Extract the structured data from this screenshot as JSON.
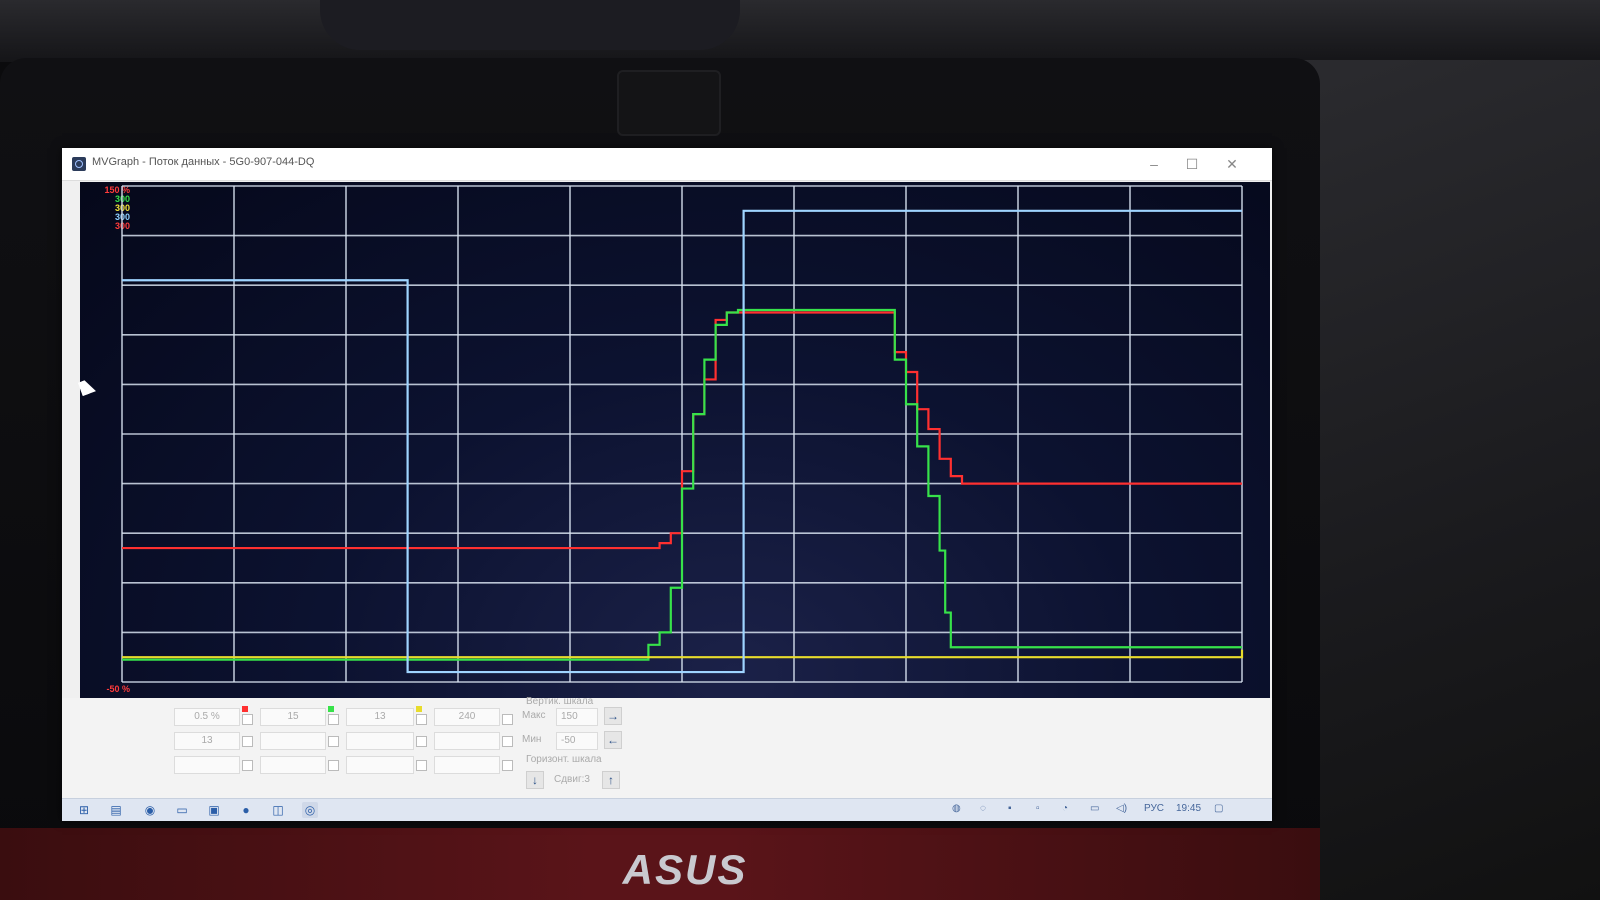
{
  "window": {
    "title": "MVGraph - Поток данных - 5G0-907-044-DQ"
  },
  "graph": {
    "scale_labels": [
      {
        "text": "150 %",
        "color": "#ff3b3b"
      },
      {
        "text": "300",
        "color": "#36e04a"
      },
      {
        "text": "300",
        "color": "#f2e23a"
      },
      {
        "text": "300",
        "color": "#8fd0ff"
      },
      {
        "text": "300",
        "color": "#ff3b3b"
      }
    ],
    "scale_min": "-50 %",
    "colors": {
      "grid": "#d8e2f0",
      "red": "#ff3030",
      "green": "#37e24a",
      "yellow": "#e8dc2c",
      "blue": "#9fd4ff"
    }
  },
  "chart_data": {
    "type": "line",
    "xlabel": "",
    "ylabel": "",
    "ylim": [
      -50,
      150
    ],
    "xlim": [
      0,
      100
    ],
    "grid": true,
    "series": [
      {
        "color": "#ff3030",
        "points": [
          [
            0,
            4
          ],
          [
            48,
            6
          ],
          [
            49,
            10
          ],
          [
            50,
            35
          ],
          [
            51,
            58
          ],
          [
            52,
            72
          ],
          [
            53,
            96
          ],
          [
            54,
            99
          ],
          [
            68,
            99
          ],
          [
            69,
            83
          ],
          [
            70,
            75
          ],
          [
            71,
            60
          ],
          [
            72,
            52
          ],
          [
            73,
            40
          ],
          [
            74,
            33
          ],
          [
            75,
            30
          ],
          [
            100,
            30
          ]
        ]
      },
      {
        "color": "#37e24a",
        "points": [
          [
            0,
            -41
          ],
          [
            47,
            -35
          ],
          [
            48,
            -30
          ],
          [
            49,
            -12
          ],
          [
            50,
            28
          ],
          [
            51,
            58
          ],
          [
            52,
            80
          ],
          [
            53,
            94
          ],
          [
            54,
            99
          ],
          [
            55,
            100
          ],
          [
            68,
            100
          ],
          [
            69,
            80
          ],
          [
            70,
            62
          ],
          [
            71,
            45
          ],
          [
            72,
            25
          ],
          [
            73,
            3
          ],
          [
            73.5,
            -22
          ],
          [
            74,
            -36
          ],
          [
            100,
            -36
          ]
        ]
      },
      {
        "color": "#e8dc2c",
        "points": [
          [
            0,
            -40
          ],
          [
            100,
            -37
          ]
        ]
      },
      {
        "color": "#9fd4ff",
        "points": [
          [
            0,
            112
          ],
          [
            25,
            112
          ],
          [
            25.5,
            -46
          ],
          [
            55,
            -46
          ],
          [
            55.5,
            140
          ],
          [
            100,
            140
          ]
        ]
      }
    ]
  },
  "panel": {
    "row1": [
      "0.5 %",
      "15",
      "13",
      "240"
    ],
    "row2": [
      "13",
      "",
      "",
      ""
    ],
    "row3": [
      "",
      "",
      "",
      ""
    ],
    "vert_scale_label": "Вертик. шкала",
    "max_label": "Макс",
    "max_value": "150",
    "min_label": "Мин",
    "min_value": "-50",
    "horiz_scale_label": "Горизонт. шкала",
    "shift_label": "Сдвиг:3"
  },
  "taskbar": {
    "lang": "РУС",
    "time": "19:45"
  },
  "brand": "ASUS"
}
